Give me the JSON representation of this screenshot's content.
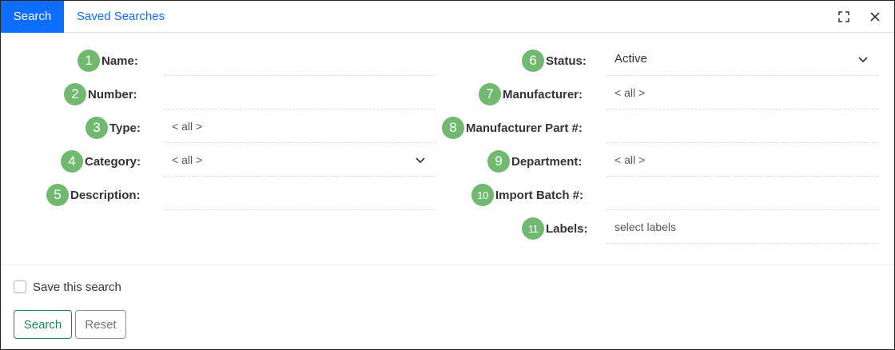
{
  "tabs": [
    {
      "label": "Search",
      "active": true
    },
    {
      "label": "Saved Searches",
      "active": false
    }
  ],
  "window_icons": [
    "expand-icon",
    "close-icon"
  ],
  "left_fields": [
    {
      "num": "1",
      "label": "Name:",
      "value": ""
    },
    {
      "num": "2",
      "label": "Number:",
      "value": ""
    },
    {
      "num": "3",
      "label": "Type:",
      "value": "< all >"
    },
    {
      "num": "4",
      "label": "Category:",
      "value": "< all >",
      "dropdown": true
    },
    {
      "num": "5",
      "label": "Description:",
      "value": ""
    }
  ],
  "right_fields": [
    {
      "num": "6",
      "label": "Status:",
      "value": "Active",
      "dropdown": true
    },
    {
      "num": "7",
      "label": "Manufacturer:",
      "value": "< all >"
    },
    {
      "num": "8",
      "label": "Manufacturer Part #:",
      "value": ""
    },
    {
      "num": "9",
      "label": "Department:",
      "value": "< all >"
    },
    {
      "num": "10",
      "label": "Import Batch #:",
      "value": ""
    },
    {
      "num": "11",
      "label": "Labels:",
      "value": "select labels"
    }
  ],
  "save_checkbox": {
    "label": "Save this search",
    "checked": false
  },
  "buttons": {
    "search": "Search",
    "reset": "Reset"
  },
  "colors": {
    "accent": "#0d6efd",
    "badge": "#71b96f",
    "success": "#198754"
  }
}
